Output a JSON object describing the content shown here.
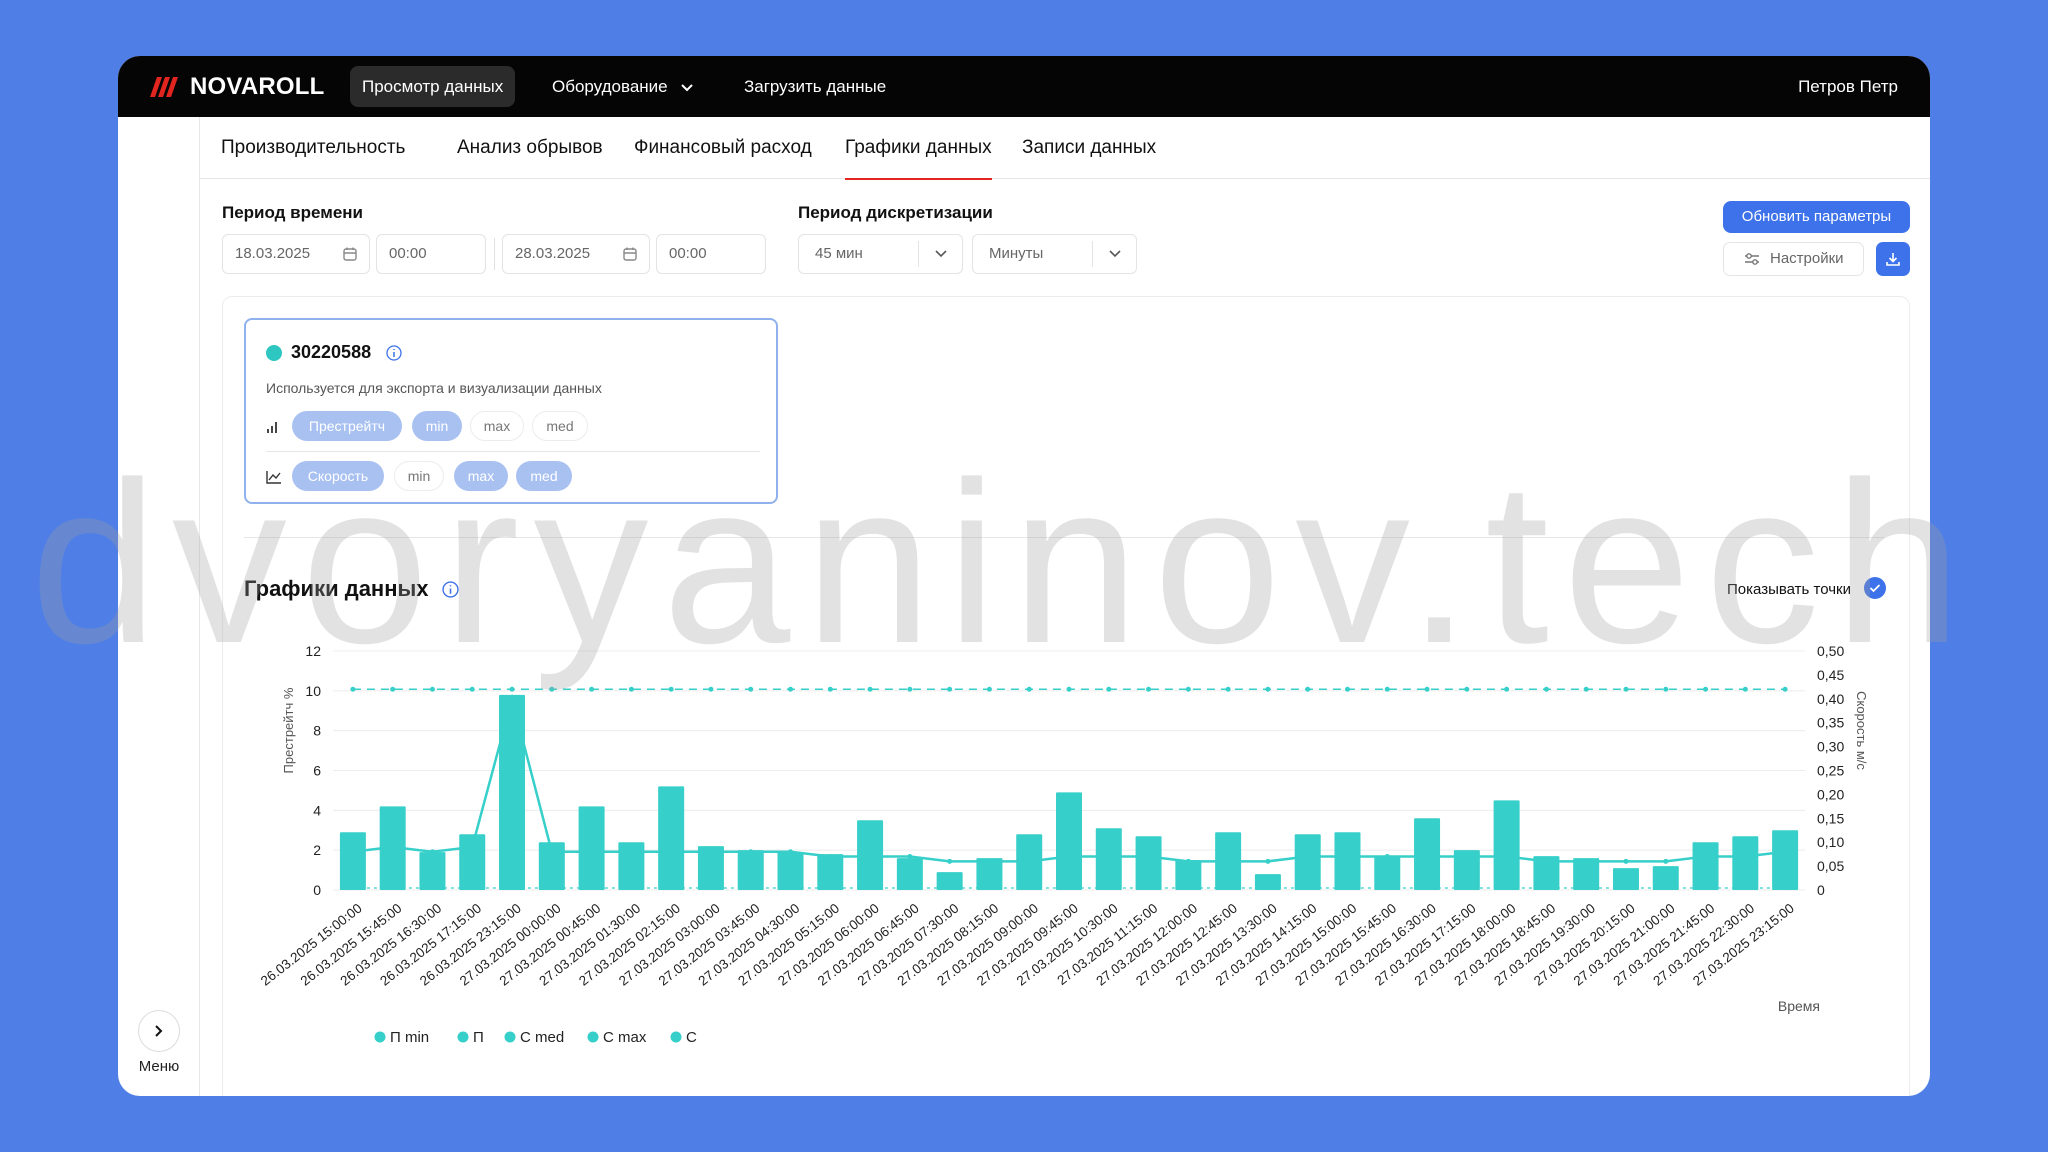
{
  "topbar": {
    "logo_text": "NOVAROLL",
    "nav": [
      {
        "label": "Просмотр данных"
      },
      {
        "label": "Оборудование"
      },
      {
        "label": "Загрузить данные"
      }
    ],
    "user": "Петров Петр"
  },
  "tabs": [
    "Производительность",
    "Анализ обрывов",
    "Финансовый расход",
    "Графики данных",
    "Записи данных"
  ],
  "filters": {
    "period_label": "Период времени",
    "date_from": "18.03.2025",
    "time_from": "00:00",
    "date_to": "28.03.2025",
    "time_to": "00:00",
    "disc_label": "Период дискретизации",
    "disc_value": "45 мин",
    "disc_unit": "Минуты"
  },
  "buttons": {
    "refresh": "Обновить параметры",
    "settings": "Настройки"
  },
  "card": {
    "id": "30220588",
    "desc": "Используется для экспорта и визуализации данных",
    "row1": [
      "Престрейтч",
      "min",
      "max",
      "med"
    ],
    "row2": [
      "Скорость",
      "min",
      "max",
      "med"
    ]
  },
  "chart_section": {
    "title": "Графики данных",
    "show_points": "Показывать точки"
  },
  "sidebar": {
    "menu_label": "Меню"
  },
  "watermark": "dvoryaninov.tech",
  "colors": {
    "accent": "#3d72ea",
    "bar": "#36cfc9",
    "active_tab_underline": "#e2261f"
  },
  "chart_data": {
    "type": "bar",
    "xlabel": "Время",
    "ylabel": "Престрейтч %",
    "ylabel_right": "Скорость м/с",
    "ylim": [
      0,
      12
    ],
    "ylim_right": [
      0,
      0.5
    ],
    "yticks": [
      "0",
      "2",
      "4",
      "6",
      "8",
      "10",
      "12"
    ],
    "yticks_right": [
      "0",
      "0,05",
      "0,10",
      "0,15",
      "0,20",
      "0,25",
      "0,30",
      "0,35",
      "0,40",
      "0,45",
      "0,50"
    ],
    "categories": [
      "26.03.2025 15:00:00",
      "26.03.2025 15:45:00",
      "26.03.2025 16:30:00",
      "26.03.2025 17:15:00",
      "26.03.2025 23:15:00",
      "27.03.2025 00:00:00",
      "27.03.2025 00:45:00",
      "27.03.2025 01:30:00",
      "27.03.2025 02:15:00",
      "27.03.2025 03:00:00",
      "27.03.2025 03:45:00",
      "27.03.2025 04:30:00",
      "27.03.2025 05:15:00",
      "27.03.2025 06:00:00",
      "27.03.2025 06:45:00",
      "27.03.2025 07:30:00",
      "27.03.2025 08:15:00",
      "27.03.2025 09:00:00",
      "27.03.2025 09:45:00",
      "27.03.2025 10:30:00",
      "27.03.2025 11:15:00",
      "27.03.2025 12:00:00",
      "27.03.2025 12:45:00",
      "27.03.2025 13:30:00",
      "27.03.2025 14:15:00",
      "27.03.2025 15:00:00",
      "27.03.2025 15:45:00",
      "27.03.2025 16:30:00",
      "27.03.2025 17:15:00",
      "27.03.2025 18:00:00",
      "27.03.2025 18:45:00",
      "27.03.2025 19:30:00",
      "27.03.2025 20:15:00",
      "27.03.2025 21:00:00",
      "27.03.2025 21:45:00",
      "27.03.2025 22:30:00",
      "27.03.2025 23:15:00"
    ],
    "series": [
      {
        "name": "П",
        "kind": "bar",
        "values": [
          2.9,
          4.2,
          1.9,
          2.8,
          9.8,
          2.4,
          4.2,
          2.4,
          5.2,
          2.2,
          2.0,
          1.9,
          1.8,
          3.5,
          1.6,
          0.9,
          1.6,
          2.8,
          4.9,
          3.1,
          2.7,
          1.5,
          2.9,
          0.8,
          2.8,
          2.9,
          1.7,
          3.6,
          2.0,
          4.5,
          1.7,
          1.6,
          1.1,
          1.2,
          2.4,
          2.7,
          3.0
        ]
      },
      {
        "name": "П min",
        "kind": "line",
        "values": [
          0.1,
          0.1,
          0.1,
          0.1,
          0.1,
          0.1,
          0.1,
          0.1,
          0.1,
          0.1,
          0.1,
          0.1,
          0.1,
          0.1,
          0.1,
          0.1,
          0.1,
          0.1,
          0.1,
          0.1,
          0.1,
          0.1,
          0.1,
          0.1,
          0.1,
          0.1,
          0.1,
          0.1,
          0.1,
          0.1,
          0.1,
          0.1,
          0.1,
          0.1,
          0.1,
          0.1,
          0.1
        ]
      },
      {
        "name": "С med",
        "kind": "line",
        "axis": "right",
        "values": [
          0.08,
          0.09,
          0.08,
          0.09,
          0.4,
          0.08,
          0.08,
          0.08,
          0.08,
          0.08,
          0.08,
          0.08,
          0.07,
          0.07,
          0.07,
          0.06,
          0.06,
          0.06,
          0.07,
          0.07,
          0.07,
          0.06,
          0.06,
          0.06,
          0.07,
          0.07,
          0.07,
          0.07,
          0.07,
          0.07,
          0.06,
          0.06,
          0.06,
          0.06,
          0.07,
          0.07,
          0.08
        ]
      },
      {
        "name": "С max",
        "kind": "line",
        "axis": "right",
        "values": [
          0.42,
          0.42,
          0.42,
          0.42,
          0.42,
          0.42,
          0.42,
          0.42,
          0.42,
          0.42,
          0.42,
          0.42,
          0.42,
          0.42,
          0.42,
          0.42,
          0.42,
          0.42,
          0.42,
          0.42,
          0.42,
          0.42,
          0.42,
          0.42,
          0.42,
          0.42,
          0.42,
          0.42,
          0.42,
          0.42,
          0.42,
          0.42,
          0.42,
          0.42,
          0.42,
          0.42,
          0.42
        ]
      },
      {
        "name": "С",
        "kind": "line",
        "axis": "right",
        "values": []
      }
    ],
    "legend": [
      "П min",
      "П",
      "С med",
      "С max",
      "С"
    ],
    "legend_position": "bottom-left",
    "grid": true
  }
}
